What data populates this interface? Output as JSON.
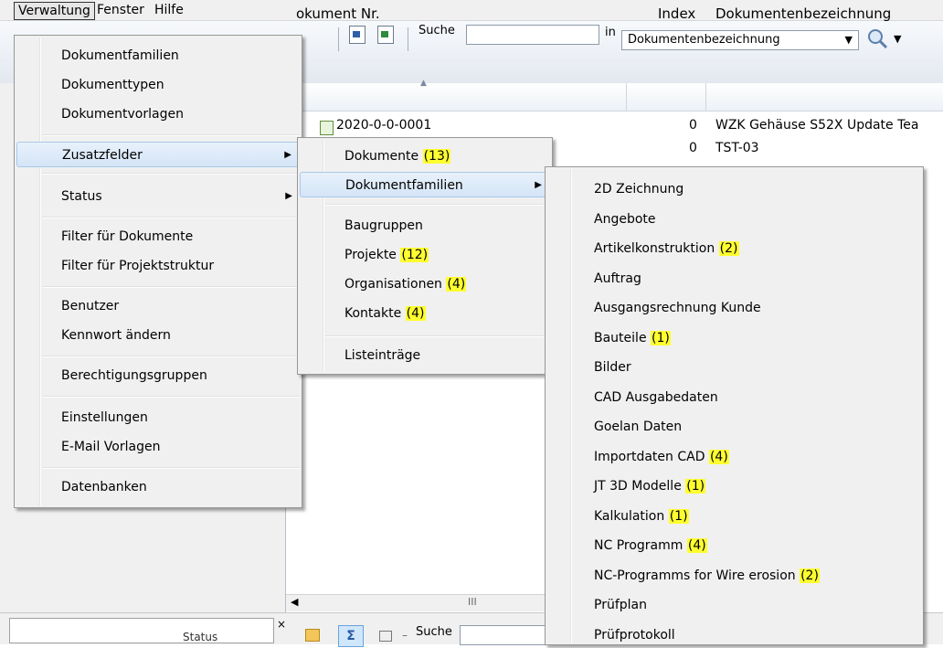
{
  "menubar": {
    "items": [
      "Verwaltung",
      "Fenster",
      "Hilfe"
    ]
  },
  "toolbar": {
    "search_label": "Suche",
    "search_value": "",
    "in_label": "in",
    "field_select": "Dokumentenbezeichnung"
  },
  "table": {
    "headers": {
      "nr": "okument Nr.",
      "index": "Index",
      "bez": "Dokumentenbezeichnung"
    },
    "rows": [
      {
        "nr": "2020-0-0-0001",
        "index": "0",
        "bez": "WZK Gehäuse S52X Update Tea"
      },
      {
        "nr": "",
        "index": "0",
        "bez": "TST-03"
      }
    ],
    "scroll_glyph": "III"
  },
  "bottom": {
    "status_fragment": "Status",
    "close_glyph": "×",
    "sum_glyph": "Σ",
    "minus_glyph": "–",
    "search_label": "Suche"
  },
  "menu_main": {
    "items": [
      "Dokumentfamilien",
      "Dokumenttypen",
      "Dokumentvorlagen",
      "Zusatzfelder",
      "Status",
      "Filter für Dokumente",
      "Filter für Projektstruktur",
      "Benutzer",
      "Kennwort ändern",
      "Berechtigungsgruppen",
      "Einstellungen",
      "E-Mail Vorlagen",
      "Datenbanken"
    ],
    "highlight": "Zusatzfelder"
  },
  "menu_zusatz": {
    "items": [
      {
        "label": "Dokumente",
        "badge": "(13)"
      },
      {
        "label": "Dokumentfamilien",
        "badge": ""
      },
      {
        "label": "Baugruppen",
        "badge": ""
      },
      {
        "label": "Projekte",
        "badge": "(12)"
      },
      {
        "label": "Organisationen",
        "badge": "(4)"
      },
      {
        "label": "Kontakte",
        "badge": "(4)"
      },
      {
        "label": "Listeinträge",
        "badge": ""
      }
    ],
    "highlight": "Dokumentfamilien"
  },
  "menu_fam": {
    "items": [
      {
        "label": "2D Zeichnung",
        "badge": ""
      },
      {
        "label": "Angebote",
        "badge": ""
      },
      {
        "label": "Artikelkonstruktion",
        "badge": "(2)"
      },
      {
        "label": "Auftrag",
        "badge": ""
      },
      {
        "label": "Ausgangsrechnung Kunde",
        "badge": ""
      },
      {
        "label": "Bauteile",
        "badge": "(1)"
      },
      {
        "label": "Bilder",
        "badge": ""
      },
      {
        "label": "CAD Ausgabedaten",
        "badge": ""
      },
      {
        "label": "Goelan Daten",
        "badge": ""
      },
      {
        "label": "Importdaten CAD",
        "badge": "(4)"
      },
      {
        "label": "JT 3D Modelle",
        "badge": "(1)"
      },
      {
        "label": "Kalkulation",
        "badge": "(1)"
      },
      {
        "label": "NC Programm",
        "badge": "(4)"
      },
      {
        "label": "NC-Programms for Wire erosion",
        "badge": "(2)"
      },
      {
        "label": "Prüfplan",
        "badge": ""
      },
      {
        "label": "Prüfprotokoll",
        "badge": ""
      }
    ]
  },
  "colors": {
    "badge_highlight": "#ffff30",
    "menu_highlight": "#d4e5f7"
  }
}
